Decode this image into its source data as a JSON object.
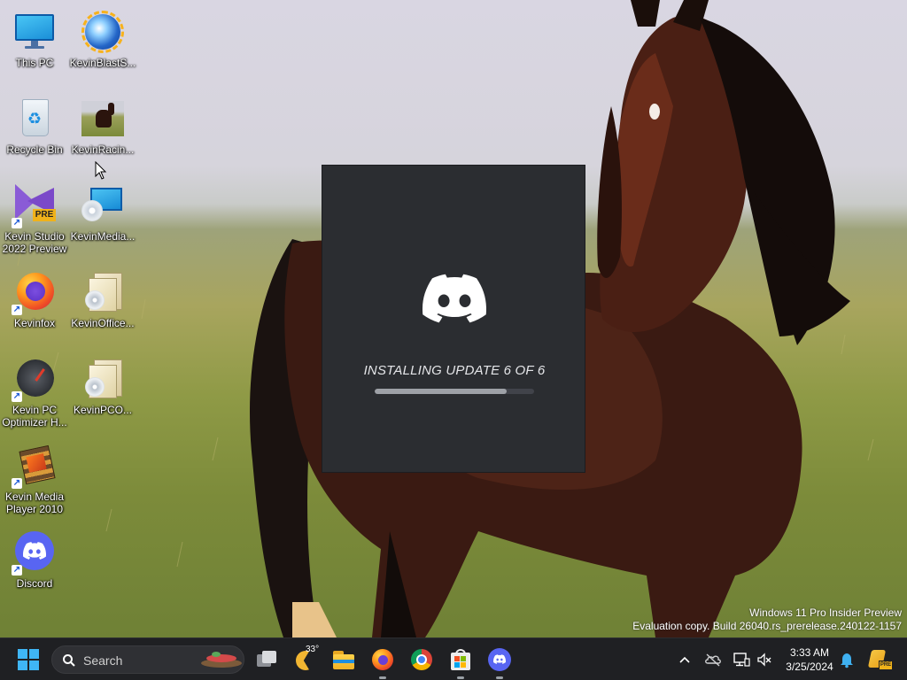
{
  "desktop": {
    "icons": [
      {
        "label": "This PC",
        "icon": "monitor-icon"
      },
      {
        "label": "KevinBlastS...",
        "icon": "blast-globe-icon"
      },
      {
        "label": "Recycle Bin",
        "icon": "recycle-bin-icon"
      },
      {
        "label": "KevinRacin...",
        "icon": "horse-thumbnail-icon"
      },
      {
        "label": "Kevin Studio\n2022 Preview",
        "icon": "visual-studio-preview-icon",
        "badge": "PRE"
      },
      {
        "label": "KevinMedia...",
        "icon": "media-disc-monitor-icon"
      },
      {
        "label": "Kevinfox",
        "icon": "firefox-icon"
      },
      {
        "label": "KevinOffice...",
        "icon": "office-installer-icon"
      },
      {
        "label": "Kevin PC\nOptimizer H...",
        "icon": "speedometer-icon"
      },
      {
        "label": "KevinPCO...",
        "icon": "installer-package-icon"
      },
      {
        "label": "Kevin Media\nPlayer 2010",
        "icon": "media-player-film-icon"
      },
      {
        "label": "Discord",
        "icon": "discord-icon"
      }
    ]
  },
  "updater": {
    "status": "INSTALLING UPDATE 6 OF 6",
    "progress": 0.83,
    "colors": {
      "background": "#2b2d31",
      "bar": "#9ea1a7",
      "track": "#41434a"
    }
  },
  "watermark": {
    "line1": "Windows 11 Pro Insider Preview",
    "line2": "Evaluation copy. Build 26040.rs_prerelease.240122-1157"
  },
  "taskbar": {
    "search_placeholder": "Search",
    "weather_temp": "33°",
    "pinned": [
      "task-view-icon",
      "weather-icon",
      "file-explorer-icon",
      "firefox-icon",
      "chrome-icon",
      "microsoft-store-icon",
      "discord-icon"
    ],
    "clock": {
      "time": "3:33 AM",
      "date": "3/25/2024"
    },
    "tray": [
      "chevron-up-icon",
      "onedrive-offline-icon",
      "network-icon",
      "volume-muted-icon",
      "notification-bell-icon",
      "copilot-preview-icon"
    ]
  }
}
